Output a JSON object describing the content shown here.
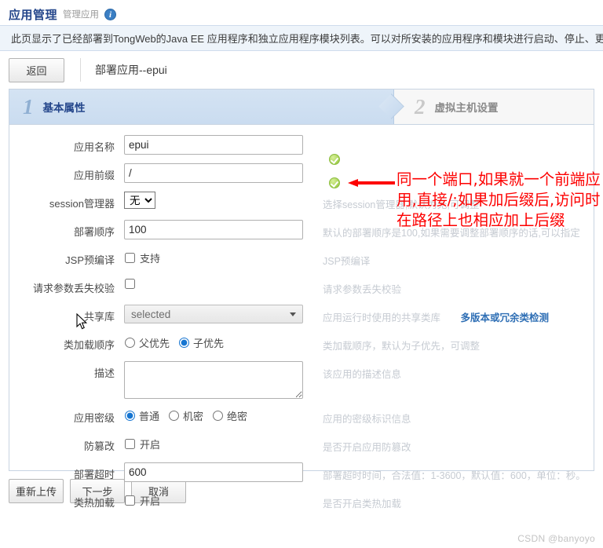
{
  "header": {
    "title": "应用管理",
    "subtitle": "管理应用",
    "info_icon": "info-icon"
  },
  "description": "此页显示了已经部署到TongWeb的Java EE 应用程序和独立应用程序模块列表。可以对所安装的应用程序和模块进行启动、停止、更新 (重新部",
  "toolbar": {
    "back_label": "返回",
    "breadcrumb": "部署应用--epui"
  },
  "steps": [
    {
      "num": "1",
      "label": "基本属性"
    },
    {
      "num": "2",
      "label": "虚拟主机设置"
    }
  ],
  "form": {
    "rows": [
      {
        "label": "应用名称",
        "value": "epui",
        "hint": ""
      },
      {
        "label": "应用前缀",
        "value": "/",
        "hint": ""
      },
      {
        "label": "session管理器",
        "value": "无",
        "hint": "选择session管理器,默认为无,可调整"
      },
      {
        "label": "部署顺序",
        "value": "100",
        "hint": "默认的部署顺序是100,如果需要调整部署顺序的话,可以指定"
      },
      {
        "label": "JSP预编译",
        "value": "支持",
        "hint": "JSP预编译"
      },
      {
        "label": "请求参数丢失校验",
        "value": "",
        "hint": "请求参数丢失校验"
      },
      {
        "label": "共享库",
        "value": "selected",
        "hint": "应用运行时使用的共享类库",
        "link": "多版本或冗余类检测"
      },
      {
        "label": "类加载顺序",
        "value": "子优先",
        "hint": "类加载顺序，默认为子优先，可调整",
        "options": [
          "父优先",
          "子优先"
        ]
      },
      {
        "label": "描述",
        "value": "",
        "hint": "该应用的描述信息"
      },
      {
        "label": "应用密级",
        "value": "普通",
        "hint": "应用的密级标识信息",
        "options": [
          "普通",
          "机密",
          "绝密"
        ]
      },
      {
        "label": "防篡改",
        "value": "开启",
        "hint": "是否开启应用防篡改"
      },
      {
        "label": "部署超时",
        "value": "600",
        "hint": "部署超时时间，合法值：1-3600，默认值：600，单位：秒。"
      },
      {
        "label": "类热加载",
        "value": "开启",
        "hint": "是否开启类热加载"
      }
    ],
    "session_options": [
      "无"
    ],
    "shared_lib_value": "selected"
  },
  "validation": {
    "ok_icon": "check-circle-icon",
    "ok_count": 2
  },
  "annotation": {
    "text": "同一个端口,如果就一个前端应用,直接/;如果加后缀后,访问时在路径上也相应加上后缀",
    "color": "#fd0000",
    "arrow": "left-arrow-icon"
  },
  "footer": {
    "buttons": [
      "重新上传",
      "下一步",
      "取消"
    ],
    "watermark": "CSDN @banyoyo"
  }
}
